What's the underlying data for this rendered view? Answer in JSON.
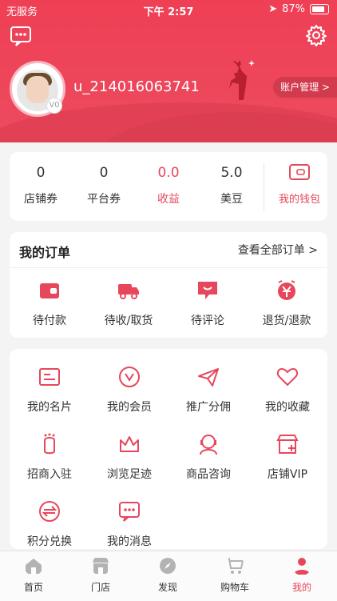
{
  "status_bar": {
    "carrier": "无服务",
    "time": "下午 2:57",
    "battery": "87%"
  },
  "profile": {
    "username": "u_214016063741",
    "account_btn": "账户管理 >",
    "vip": "V0"
  },
  "stats": [
    {
      "value": "0",
      "label": "店铺券"
    },
    {
      "value": "0",
      "label": "平台券"
    },
    {
      "value": "0.0",
      "label": "收益"
    },
    {
      "value": "5.0",
      "label": "美豆"
    }
  ],
  "wallet_label": "我的钱包",
  "orders": {
    "title": "我的订单",
    "view_all": "查看全部订单 >",
    "items": [
      {
        "label": "待付款",
        "icon": "wallet-icon"
      },
      {
        "label": "待收/取货",
        "icon": "truck-icon"
      },
      {
        "label": "待评论",
        "icon": "comment-icon"
      },
      {
        "label": "退货/退款",
        "icon": "refund-icon"
      }
    ]
  },
  "menu": {
    "items": [
      {
        "label": "我的名片",
        "icon": "card-icon"
      },
      {
        "label": "我的会员",
        "icon": "member-icon"
      },
      {
        "label": "推广分佣",
        "icon": "send-icon"
      },
      {
        "label": "我的收藏",
        "icon": "heart-icon"
      },
      {
        "label": "招商入驻",
        "icon": "footprint-icon"
      },
      {
        "label": "浏览足迹",
        "icon": "crown-icon"
      },
      {
        "label": "商品咨询",
        "icon": "support-icon"
      },
      {
        "label": "店铺VIP",
        "icon": "store-icon"
      },
      {
        "label": "积分兑换",
        "icon": "exchange-icon"
      },
      {
        "label": "我的消息",
        "icon": "message-icon"
      }
    ]
  },
  "tabs": [
    {
      "label": "首页"
    },
    {
      "label": "门店"
    },
    {
      "label": "发现"
    },
    {
      "label": "购物车"
    },
    {
      "label": "我的"
    }
  ],
  "colors": {
    "accent": "#e7475c",
    "hero": "#ef3f55"
  }
}
